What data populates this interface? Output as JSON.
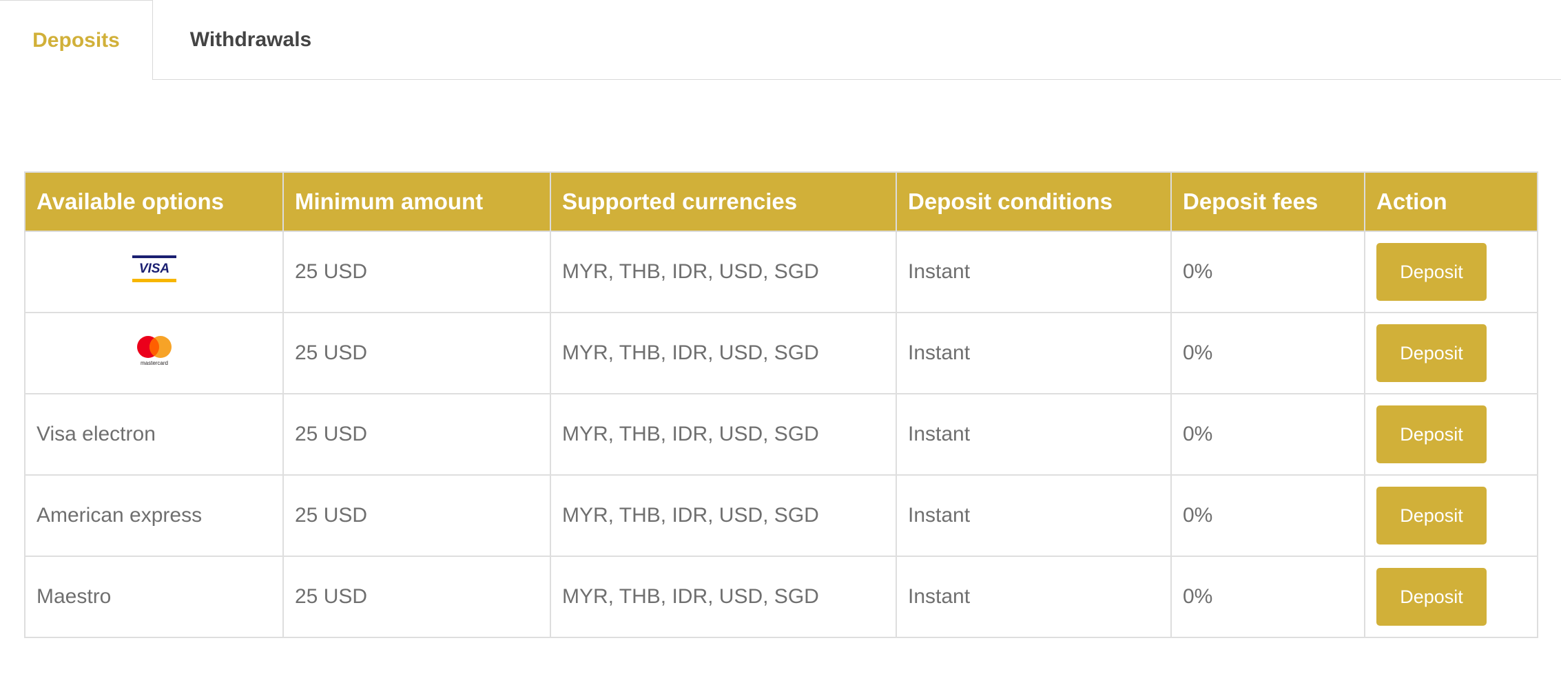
{
  "colors": {
    "accent": "#d1b039",
    "tab_inactive_text": "#444444",
    "cell_text": "#6f6f6f",
    "border": "#dedede"
  },
  "tabs": [
    {
      "label": "Deposits",
      "active": true
    },
    {
      "label": "Withdrawals",
      "active": false
    }
  ],
  "table": {
    "headers": [
      "Available options",
      "Minimum amount",
      "Supported currencies",
      "Deposit conditions",
      "Deposit fees",
      "Action"
    ],
    "rows": [
      {
        "option": "",
        "logo": "visa-logo",
        "logo_text": "VISA",
        "min_amount": "25 USD",
        "currencies": "MYR, THB, IDR, USD, SGD",
        "conditions": "Instant",
        "fees": "0%",
        "action": "Deposit"
      },
      {
        "option": "",
        "logo": "mastercard-logo",
        "logo_text": "mastercard",
        "min_amount": "25 USD",
        "currencies": "MYR, THB, IDR, USD, SGD",
        "conditions": "Instant",
        "fees": "0%",
        "action": "Deposit"
      },
      {
        "option": "Visa electron",
        "min_amount": "25 USD",
        "currencies": "MYR, THB, IDR, USD, SGD",
        "conditions": "Instant",
        "fees": "0%",
        "action": "Deposit"
      },
      {
        "option": "American express",
        "min_amount": "25 USD",
        "currencies": "MYR, THB, IDR, USD, SGD",
        "conditions": "Instant",
        "fees": "0%",
        "action": "Deposit"
      },
      {
        "option": "Maestro",
        "min_amount": "25 USD",
        "currencies": "MYR, THB, IDR, USD, SGD",
        "conditions": "Instant",
        "fees": "0%",
        "action": "Deposit"
      }
    ]
  }
}
